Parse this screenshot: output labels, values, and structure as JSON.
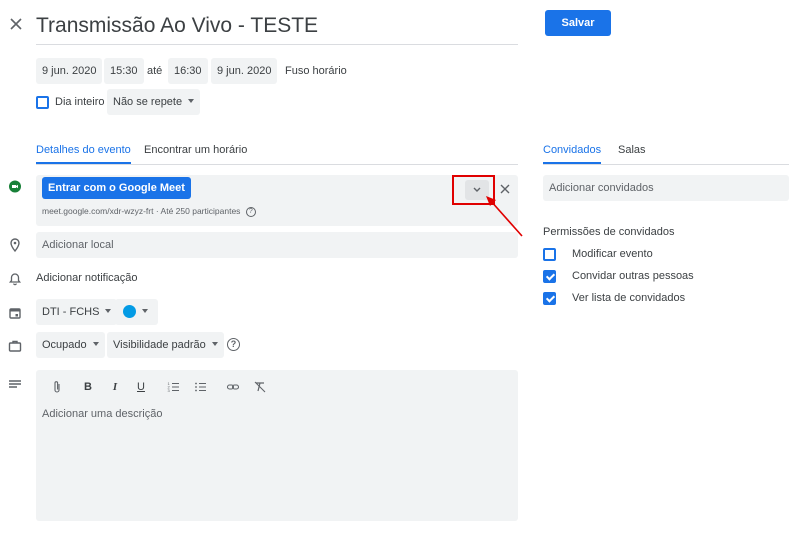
{
  "header": {
    "title": "Transmissão Ao Vivo - TESTE",
    "save_label": "Salvar"
  },
  "datetime": {
    "start_date": "9 jun. 2020",
    "start_time": "15:30",
    "separator": "até",
    "end_time": "16:30",
    "end_date": "9 jun. 2020",
    "timezone_label": "Fuso horário",
    "all_day_label": "Dia inteiro",
    "repeat_label": "Não se repete"
  },
  "tabs": {
    "details": "Detalhes do evento",
    "find_time": "Encontrar um horário",
    "guests": "Convidados",
    "rooms": "Salas"
  },
  "meet": {
    "join_label": "Entrar com o Google Meet",
    "info": "meet.google.com/xdr-wzyz-frt · Até 250 participantes"
  },
  "location": {
    "placeholder": "Adicionar local"
  },
  "notification": {
    "label": "Adicionar notificação"
  },
  "calendar": {
    "name": "DTI - FCHS",
    "color": "#039be5"
  },
  "availability": {
    "busy_label": "Ocupado",
    "visibility_label": "Visibilidade padrão"
  },
  "description": {
    "placeholder": "Adicionar uma descrição"
  },
  "guests": {
    "placeholder": "Adicionar convidados",
    "permissions_title": "Permissões de convidados",
    "permissions": [
      {
        "label": "Modificar evento",
        "checked": false
      },
      {
        "label": "Convidar outras pessoas",
        "checked": true
      },
      {
        "label": "Ver lista de convidados",
        "checked": true
      }
    ]
  },
  "colors": {
    "accent": "#1a73e8",
    "annotation": "#e00000",
    "field_bg": "#f1f3f4"
  }
}
